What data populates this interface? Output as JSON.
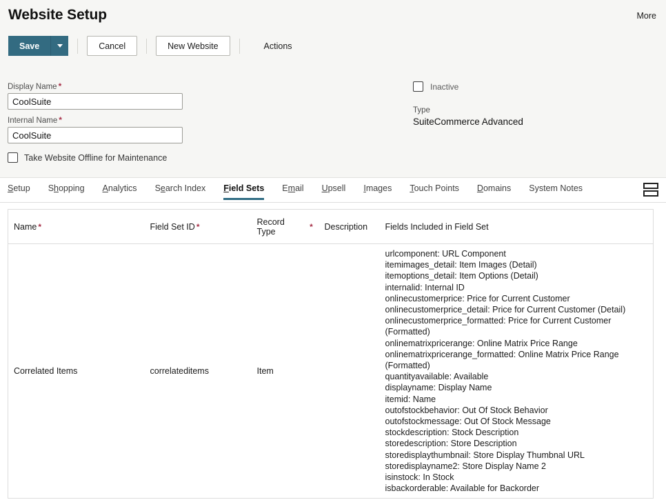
{
  "header": {
    "title": "Website Setup",
    "more_label": "More"
  },
  "toolbar": {
    "save_label": "Save",
    "save_dropdown_name": "save-options-dropdown",
    "cancel_label": "Cancel",
    "new_website_label": "New Website",
    "actions_label": "Actions"
  },
  "form": {
    "display_name": {
      "label": "Display Name",
      "required_mark": "*",
      "value": "CoolSuite",
      "placeholder": ""
    },
    "internal_name": {
      "label": "Internal Name",
      "required_mark": "*",
      "value": "CoolSuite",
      "placeholder": ""
    },
    "offline_checkbox": {
      "label": "Take Website Offline for Maintenance",
      "checked": false
    },
    "inactive_checkbox": {
      "label": "Inactive",
      "checked": false
    },
    "type": {
      "label": "Type",
      "value": "SuiteCommerce Advanced"
    }
  },
  "tabs": [
    {
      "label": "Setup",
      "accesskey_index": 0,
      "active": false
    },
    {
      "label": "Shopping",
      "accesskey_index": 1,
      "active": false
    },
    {
      "label": "Analytics",
      "accesskey_index": 0,
      "active": false
    },
    {
      "label": "Search Index",
      "accesskey_index": 1,
      "active": false
    },
    {
      "label": "Field Sets",
      "accesskey_index": 0,
      "active": true
    },
    {
      "label": "Email",
      "accesskey_index": 1,
      "active": false
    },
    {
      "label": "Upsell",
      "accesskey_index": 0,
      "active": false
    },
    {
      "label": "Images",
      "accesskey_index": 0,
      "active": false
    },
    {
      "label": "Touch Points",
      "accesskey_index": 0,
      "active": false
    },
    {
      "label": "Domains",
      "accesskey_index": 0,
      "active": false
    },
    {
      "label": "System Notes",
      "accesskey_index": -1,
      "active": false
    }
  ],
  "layout_toggle": {
    "icon": "stacked-panes-icon"
  },
  "table": {
    "columns": [
      {
        "label": "Name",
        "required": true
      },
      {
        "label": "Field Set ID",
        "required": true
      },
      {
        "label": "Record Type",
        "required": true
      },
      {
        "label": "Description",
        "required": false
      },
      {
        "label": "Fields Included in Field Set",
        "required": false
      }
    ],
    "required_mark": "*",
    "rows": [
      {
        "name": "Correlated Items",
        "field_set_id": "correlateditems",
        "record_type": "Item",
        "description": "",
        "fields": [
          "urlcomponent: URL Component",
          "itemimages_detail: Item Images (Detail)",
          "itemoptions_detail: Item Options (Detail)",
          "internalid: Internal ID",
          "onlinecustomerprice: Price for Current Customer",
          "onlinecustomerprice_detail: Price for Current Customer (Detail)",
          "onlinecustomerprice_formatted: Price for Current Customer (Formatted)",
          "onlinematrixpricerange: Online Matrix Price Range",
          "onlinematrixpricerange_formatted: Online Matrix Price Range (Formatted)",
          "quantityavailable: Available",
          "displayname: Display Name",
          "itemid: Name",
          "outofstockbehavior: Out Of Stock Behavior",
          "outofstockmessage: Out Of Stock Message",
          "stockdescription: Stock Description",
          "storedescription: Store Description",
          "storedisplaythumbnail: Store Display Thumbnal URL",
          "storedisplayname2: Store Display Name 2",
          "isinstock: In Stock",
          "isbackorderable: Available for Backorder"
        ]
      }
    ]
  },
  "colors": {
    "accent": "#336b81",
    "required": "#a8324a",
    "panel_bg": "#f6f6f4"
  }
}
